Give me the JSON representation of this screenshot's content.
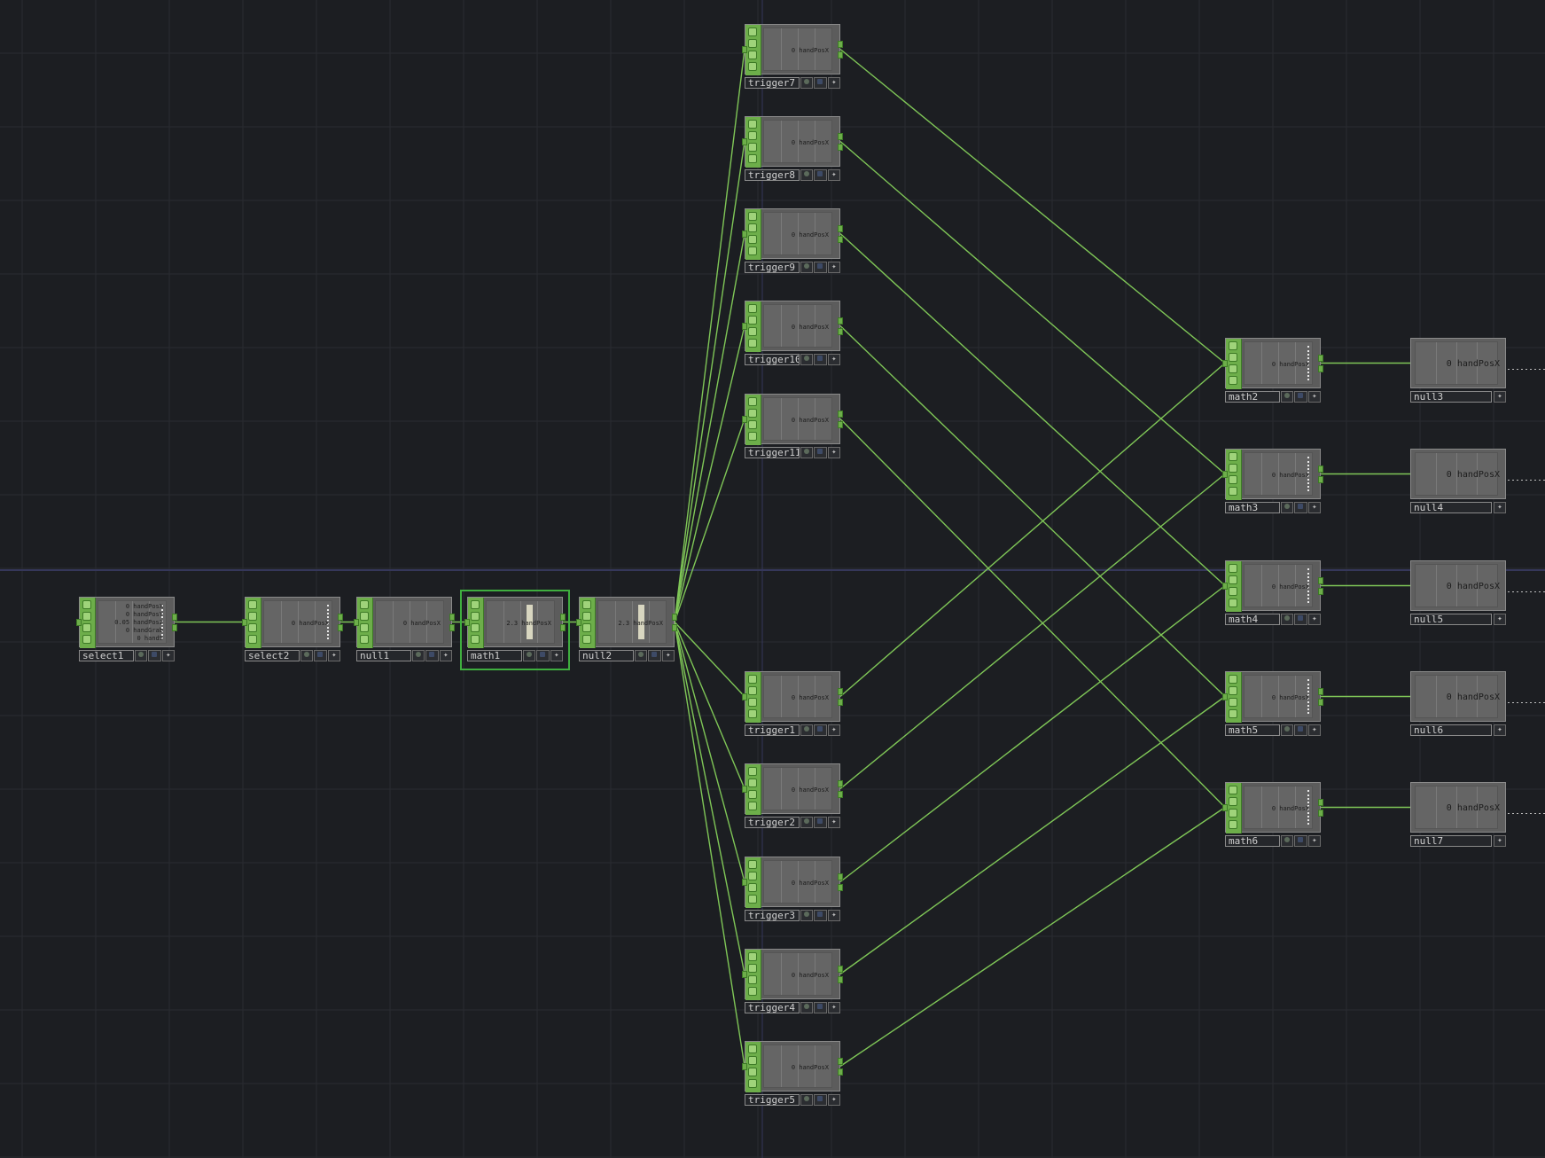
{
  "editor": {
    "theme": {
      "background": "#1c1e22",
      "grid": "#2a2c31",
      "wire": "#7fc657",
      "accent": "#6dae4a",
      "selection": "#3fae3f"
    }
  },
  "nodes": [
    {
      "id": "select1",
      "label": "select1",
      "type": "chop",
      "values": [
        "0  handPosX",
        "0  handPosY",
        "0.05 handPosZ",
        "0  handGrab",
        "0  handS"
      ]
    },
    {
      "id": "select2",
      "label": "select2",
      "type": "chop",
      "values": [
        "0  handPosX"
      ]
    },
    {
      "id": "null1",
      "label": "null1",
      "type": "chop",
      "values": [
        "0  handPosX"
      ]
    },
    {
      "id": "math1",
      "label": "math1",
      "type": "chop",
      "values": [
        "2.3  handPosX"
      ],
      "selected": true
    },
    {
      "id": "null2",
      "label": "null2",
      "type": "chop",
      "values": [
        "2.3  handPosX"
      ]
    },
    {
      "id": "trigger7",
      "label": "trigger7",
      "type": "chop",
      "values": [
        "0  handPosX"
      ]
    },
    {
      "id": "trigger8",
      "label": "trigger8",
      "type": "chop",
      "values": [
        "0  handPosX"
      ]
    },
    {
      "id": "trigger9",
      "label": "trigger9",
      "type": "chop",
      "values": [
        "0  handPosX"
      ]
    },
    {
      "id": "trigger10",
      "label": "trigger10",
      "type": "chop",
      "values": [
        "0  handPosX"
      ]
    },
    {
      "id": "trigger11",
      "label": "trigger11",
      "type": "chop",
      "values": [
        "0  handPosX"
      ]
    },
    {
      "id": "trigger1",
      "label": "trigger1",
      "type": "chop",
      "values": [
        "0  handPosX"
      ]
    },
    {
      "id": "trigger2",
      "label": "trigger2",
      "type": "chop",
      "values": [
        "0  handPosX"
      ]
    },
    {
      "id": "trigger3",
      "label": "trigger3",
      "type": "chop",
      "values": [
        "0  handPosX"
      ]
    },
    {
      "id": "trigger4",
      "label": "trigger4",
      "type": "chop",
      "values": [
        "0  handPosX"
      ]
    },
    {
      "id": "trigger5",
      "label": "trigger5",
      "type": "chop",
      "values": [
        "0  handPosX"
      ]
    },
    {
      "id": "math2",
      "label": "math2",
      "type": "chop",
      "values": [
        "0  handPosX"
      ]
    },
    {
      "id": "math3",
      "label": "math3",
      "type": "chop",
      "values": [
        "0  handPosX"
      ]
    },
    {
      "id": "math4",
      "label": "math4",
      "type": "chop",
      "values": [
        "0  handPosX"
      ]
    },
    {
      "id": "math5",
      "label": "math5",
      "type": "chop",
      "values": [
        "0  handPosX"
      ]
    },
    {
      "id": "math6",
      "label": "math6",
      "type": "chop",
      "values": [
        "0  handPosX"
      ]
    },
    {
      "id": "null3",
      "label": "null3",
      "type": "out",
      "values": [
        "0  handPosX"
      ]
    },
    {
      "id": "null4",
      "label": "null4",
      "type": "out",
      "values": [
        "0  handPosX"
      ]
    },
    {
      "id": "null5",
      "label": "null5",
      "type": "out",
      "values": [
        "0  handPosX"
      ]
    },
    {
      "id": "null6",
      "label": "null6",
      "type": "out",
      "values": [
        "0  handPosX"
      ]
    },
    {
      "id": "null7",
      "label": "null7",
      "type": "out",
      "values": [
        "0  handPosX"
      ]
    }
  ],
  "connections": [
    [
      "select1",
      "select2"
    ],
    [
      "select2",
      "null1"
    ],
    [
      "null1",
      "math1"
    ],
    [
      "math1",
      "null2"
    ],
    [
      "null2",
      "trigger7"
    ],
    [
      "null2",
      "trigger8"
    ],
    [
      "null2",
      "trigger9"
    ],
    [
      "null2",
      "trigger10"
    ],
    [
      "null2",
      "trigger11"
    ],
    [
      "null2",
      "trigger1"
    ],
    [
      "null2",
      "trigger2"
    ],
    [
      "null2",
      "trigger3"
    ],
    [
      "null2",
      "trigger4"
    ],
    [
      "null2",
      "trigger5"
    ],
    [
      "trigger7",
      "math2"
    ],
    [
      "trigger8",
      "math3"
    ],
    [
      "trigger9",
      "math4"
    ],
    [
      "trigger10",
      "math5"
    ],
    [
      "trigger11",
      "math6"
    ],
    [
      "trigger1",
      "math2"
    ],
    [
      "trigger2",
      "math3"
    ],
    [
      "trigger3",
      "math4"
    ],
    [
      "trigger4",
      "math5"
    ],
    [
      "trigger5",
      "math6"
    ],
    [
      "math2",
      "null3"
    ],
    [
      "math3",
      "null4"
    ],
    [
      "math4",
      "null5"
    ],
    [
      "math5",
      "null6"
    ],
    [
      "math6",
      "null7"
    ]
  ]
}
